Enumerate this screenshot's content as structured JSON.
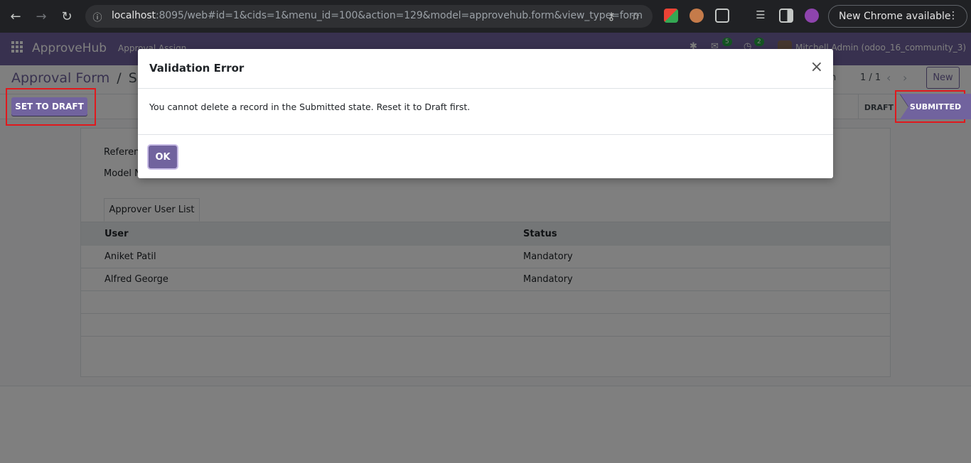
{
  "browser": {
    "url_host": "localhost",
    "url_rest": ":8095/web#id=1&cids=1&menu_id=100&action=129&model=approvehub.form&view_type=form",
    "new_chrome_label": "New Chrome available"
  },
  "navbar": {
    "brand": "ApproveHub",
    "menu": "Approval Assign",
    "messages_count": "5",
    "activities_count": "2",
    "user": "Mitchell Admin (odoo_16_community_3)"
  },
  "control": {
    "breadcrumb_parent": "Approval Form",
    "breadcrumb_sep": "/",
    "breadcrumb_current": "Sale",
    "pager_hint": "n",
    "pager": "1 / 1",
    "new_label": "New"
  },
  "statusbar": {
    "set_to_draft_label": "SET TO DRAFT",
    "stages": [
      "DRAFT",
      "SUBMITTED"
    ]
  },
  "form": {
    "label_reference": "Referen",
    "label_model": "Model N",
    "tab_label": "Approver User List",
    "columns": [
      "User",
      "Status"
    ],
    "rows": [
      {
        "user": "Aniket Patil",
        "status": "Mandatory"
      },
      {
        "user": "Alfred George",
        "status": "Mandatory"
      }
    ]
  },
  "dialog": {
    "title": "Validation Error",
    "message": "You cannot delete a record in the Submitted state. Reset it to Draft first.",
    "ok_label": "OK",
    "close_symbol": "×"
  },
  "colors": {
    "brand": "#71639e",
    "highlight": "#e0191d"
  }
}
